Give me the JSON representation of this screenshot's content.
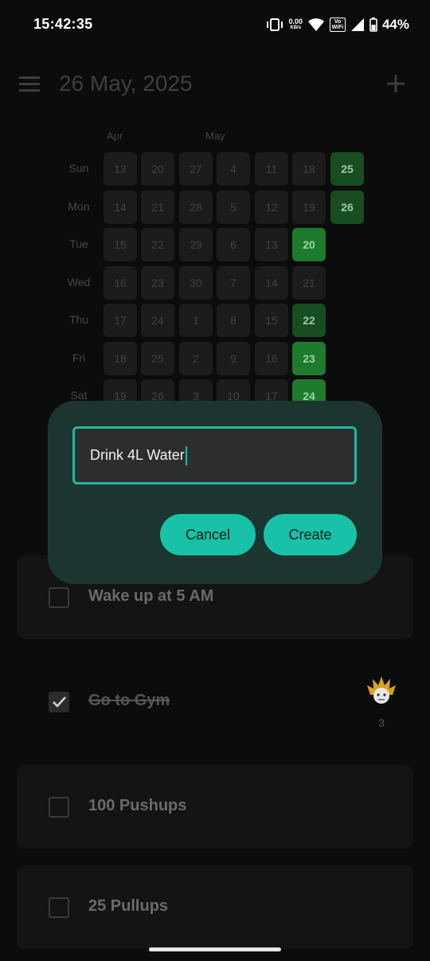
{
  "status_bar": {
    "time": "15:42:35",
    "net_speed": "0.00",
    "net_unit": "KB/s",
    "vowifi_top": "Vo",
    "vowifi_bottom": "WiFi",
    "battery": "44%"
  },
  "app_bar": {
    "title": "26 May, 2025"
  },
  "heatmap": {
    "months": [
      "Apr",
      "May"
    ],
    "day_labels": [
      "Sun",
      "Mon",
      "Tue",
      "Wed",
      "Thu",
      "Fri",
      "Sat"
    ],
    "weeks": [
      [
        "13",
        "14",
        "15",
        "16",
        "17",
        "18",
        "19"
      ],
      [
        "20",
        "21",
        "22",
        "23",
        "24",
        "25",
        "26"
      ],
      [
        "27",
        "28",
        "29",
        "30",
        "1",
        "2",
        "3"
      ],
      [
        "4",
        "5",
        "6",
        "7",
        "8",
        "9",
        "10"
      ],
      [
        "11",
        "12",
        "13",
        "14",
        "15",
        "16",
        "17"
      ],
      [
        "18",
        "19",
        "20",
        "21",
        "22",
        "23",
        "24"
      ],
      [
        "25",
        "26",
        "",
        "",
        "",
        "",
        ""
      ]
    ],
    "completed_dates": [
      "20",
      "22",
      "23",
      "24",
      "25",
      "26"
    ]
  },
  "dialog": {
    "input_value": "Drink 4L Water",
    "cancel_label": "Cancel",
    "create_label": "Create"
  },
  "habits": [
    {
      "label": "Wake up at 5 AM",
      "checked": false
    },
    {
      "label": "Go to Gym",
      "checked": true,
      "streak": "3"
    },
    {
      "label": "100 Pushups",
      "checked": false
    },
    {
      "label": "25 Pullups",
      "checked": false
    }
  ],
  "colors": {
    "accent": "#17c2a8",
    "dialog_bg": "#1c3531",
    "completed_day": "#1e7a2c"
  }
}
